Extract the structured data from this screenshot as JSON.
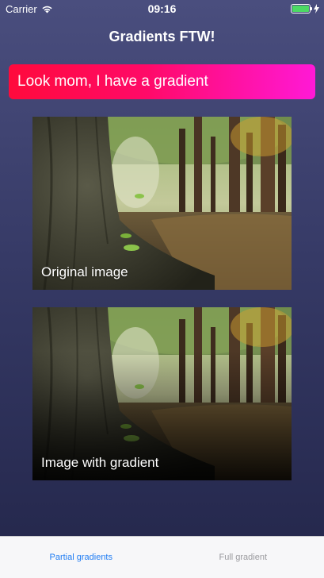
{
  "status_bar": {
    "carrier": "Carrier",
    "time": "09:16",
    "battery_level": 1.0,
    "battery_color": "#4cd964"
  },
  "nav": {
    "title": "Gradients FTW!"
  },
  "gradient_label": {
    "text": "Look mom, I have a gradient",
    "colors": [
      "#ff0a3c",
      "#ff19d6"
    ]
  },
  "images": [
    {
      "caption": "Original image"
    },
    {
      "caption": "Image with gradient"
    }
  ],
  "tabs": [
    {
      "label": "Partial gradients",
      "active": true
    },
    {
      "label": "Full gradient",
      "active": false
    }
  ],
  "colors": {
    "active_tab": "#1f7cf3",
    "inactive_tab": "#9a9a9e"
  }
}
